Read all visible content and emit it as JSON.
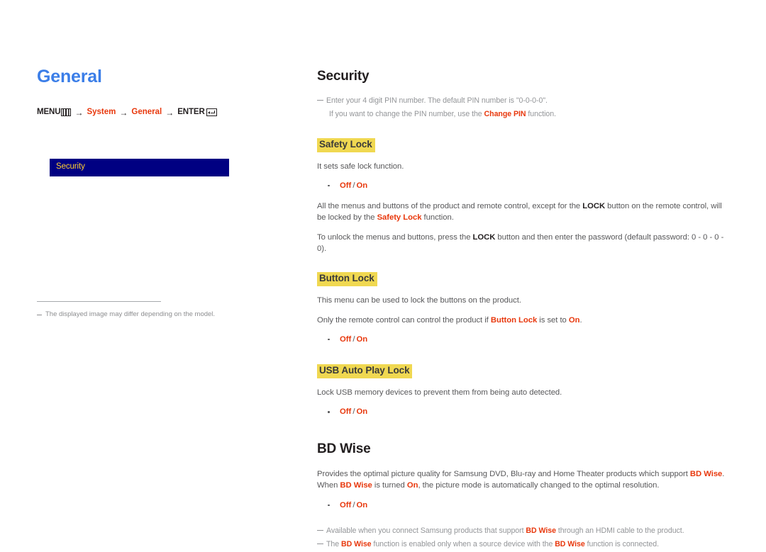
{
  "left": {
    "page_title": "General",
    "breadcrumb": {
      "menu_label": "MENU",
      "menu_icon": "menu-grid-icon",
      "arrow": "→",
      "item1": "System",
      "item2": "General",
      "enter_label": "ENTER",
      "enter_icon": "enter-return-icon"
    },
    "osd": {
      "item_label": "Security",
      "bg_color": "#000082",
      "text_color": "#ffcf33"
    },
    "footnote": "The displayed image may differ depending on the model."
  },
  "right": {
    "security": {
      "title": "Security",
      "note_line1": "Enter your 4 digit PIN number. The default PIN number is \"0-0-0-0\".",
      "note_line2_pre": "If you want to change the PIN number, use the ",
      "note_line2_bold": "Change PIN",
      "note_line2_post": " function.",
      "safety_lock": {
        "title": "Safety Lock",
        "desc": "It sets safe lock function.",
        "options": {
          "off": "Off",
          "sep": "/",
          "on": "On"
        },
        "para1_a": "All the menus and buttons of the product and remote control, except for the ",
        "para1_b": "LOCK",
        "para1_c": " button on the remote control, will be locked by the ",
        "para1_d": "Safety Lock",
        "para1_e": " function.",
        "para2_a": "To unlock the menus and buttons, press the ",
        "para2_b": "LOCK",
        "para2_c": " button and then enter the password (default password: 0 - 0 - 0 - 0)."
      },
      "button_lock": {
        "title": "Button Lock",
        "desc": "This menu can be used to lock the buttons on the product.",
        "para_a": "Only the remote control can control the product if ",
        "para_b": "Button Lock",
        "para_c": " is set to ",
        "para_d": "On",
        "para_e": ".",
        "options": {
          "off": "Off",
          "sep": "/",
          "on": "On"
        }
      },
      "usb_auto_play_lock": {
        "title": "USB Auto Play Lock",
        "desc": "Lock USB memory devices to prevent them from being auto detected.",
        "options": {
          "off": "Off",
          "sep": "/",
          "on": "On"
        }
      }
    },
    "bd_wise": {
      "title": "BD Wise",
      "para_a": "Provides the optimal picture quality for Samsung DVD, Blu-ray and Home Theater products which support ",
      "para_b": "BD Wise",
      "para_c": ". When ",
      "para_d": "BD Wise",
      "para_e": " is turned ",
      "para_f": "On",
      "para_g": ", the picture mode is automatically changed to the optimal resolution.",
      "options": {
        "off": "Off",
        "sep": "/",
        "on": "On"
      },
      "note1_a": "Available when you connect Samsung products that support ",
      "note1_b": "BD Wise",
      "note1_c": " through an HDMI cable to the product.",
      "note2_a": "The ",
      "note2_b": "BD Wise",
      "note2_c": " function is enabled only when a source device with the ",
      "note2_d": "BD Wise",
      "note2_e": " function is connected."
    }
  },
  "colors": {
    "accent_blue": "#3b7ee8",
    "accent_red": "#e8380d",
    "highlight_yellow": "#f0d851",
    "osd_navy": "#000082",
    "osd_gold": "#ffcf33",
    "body_gray": "#58585a",
    "note_gray": "#939598"
  }
}
